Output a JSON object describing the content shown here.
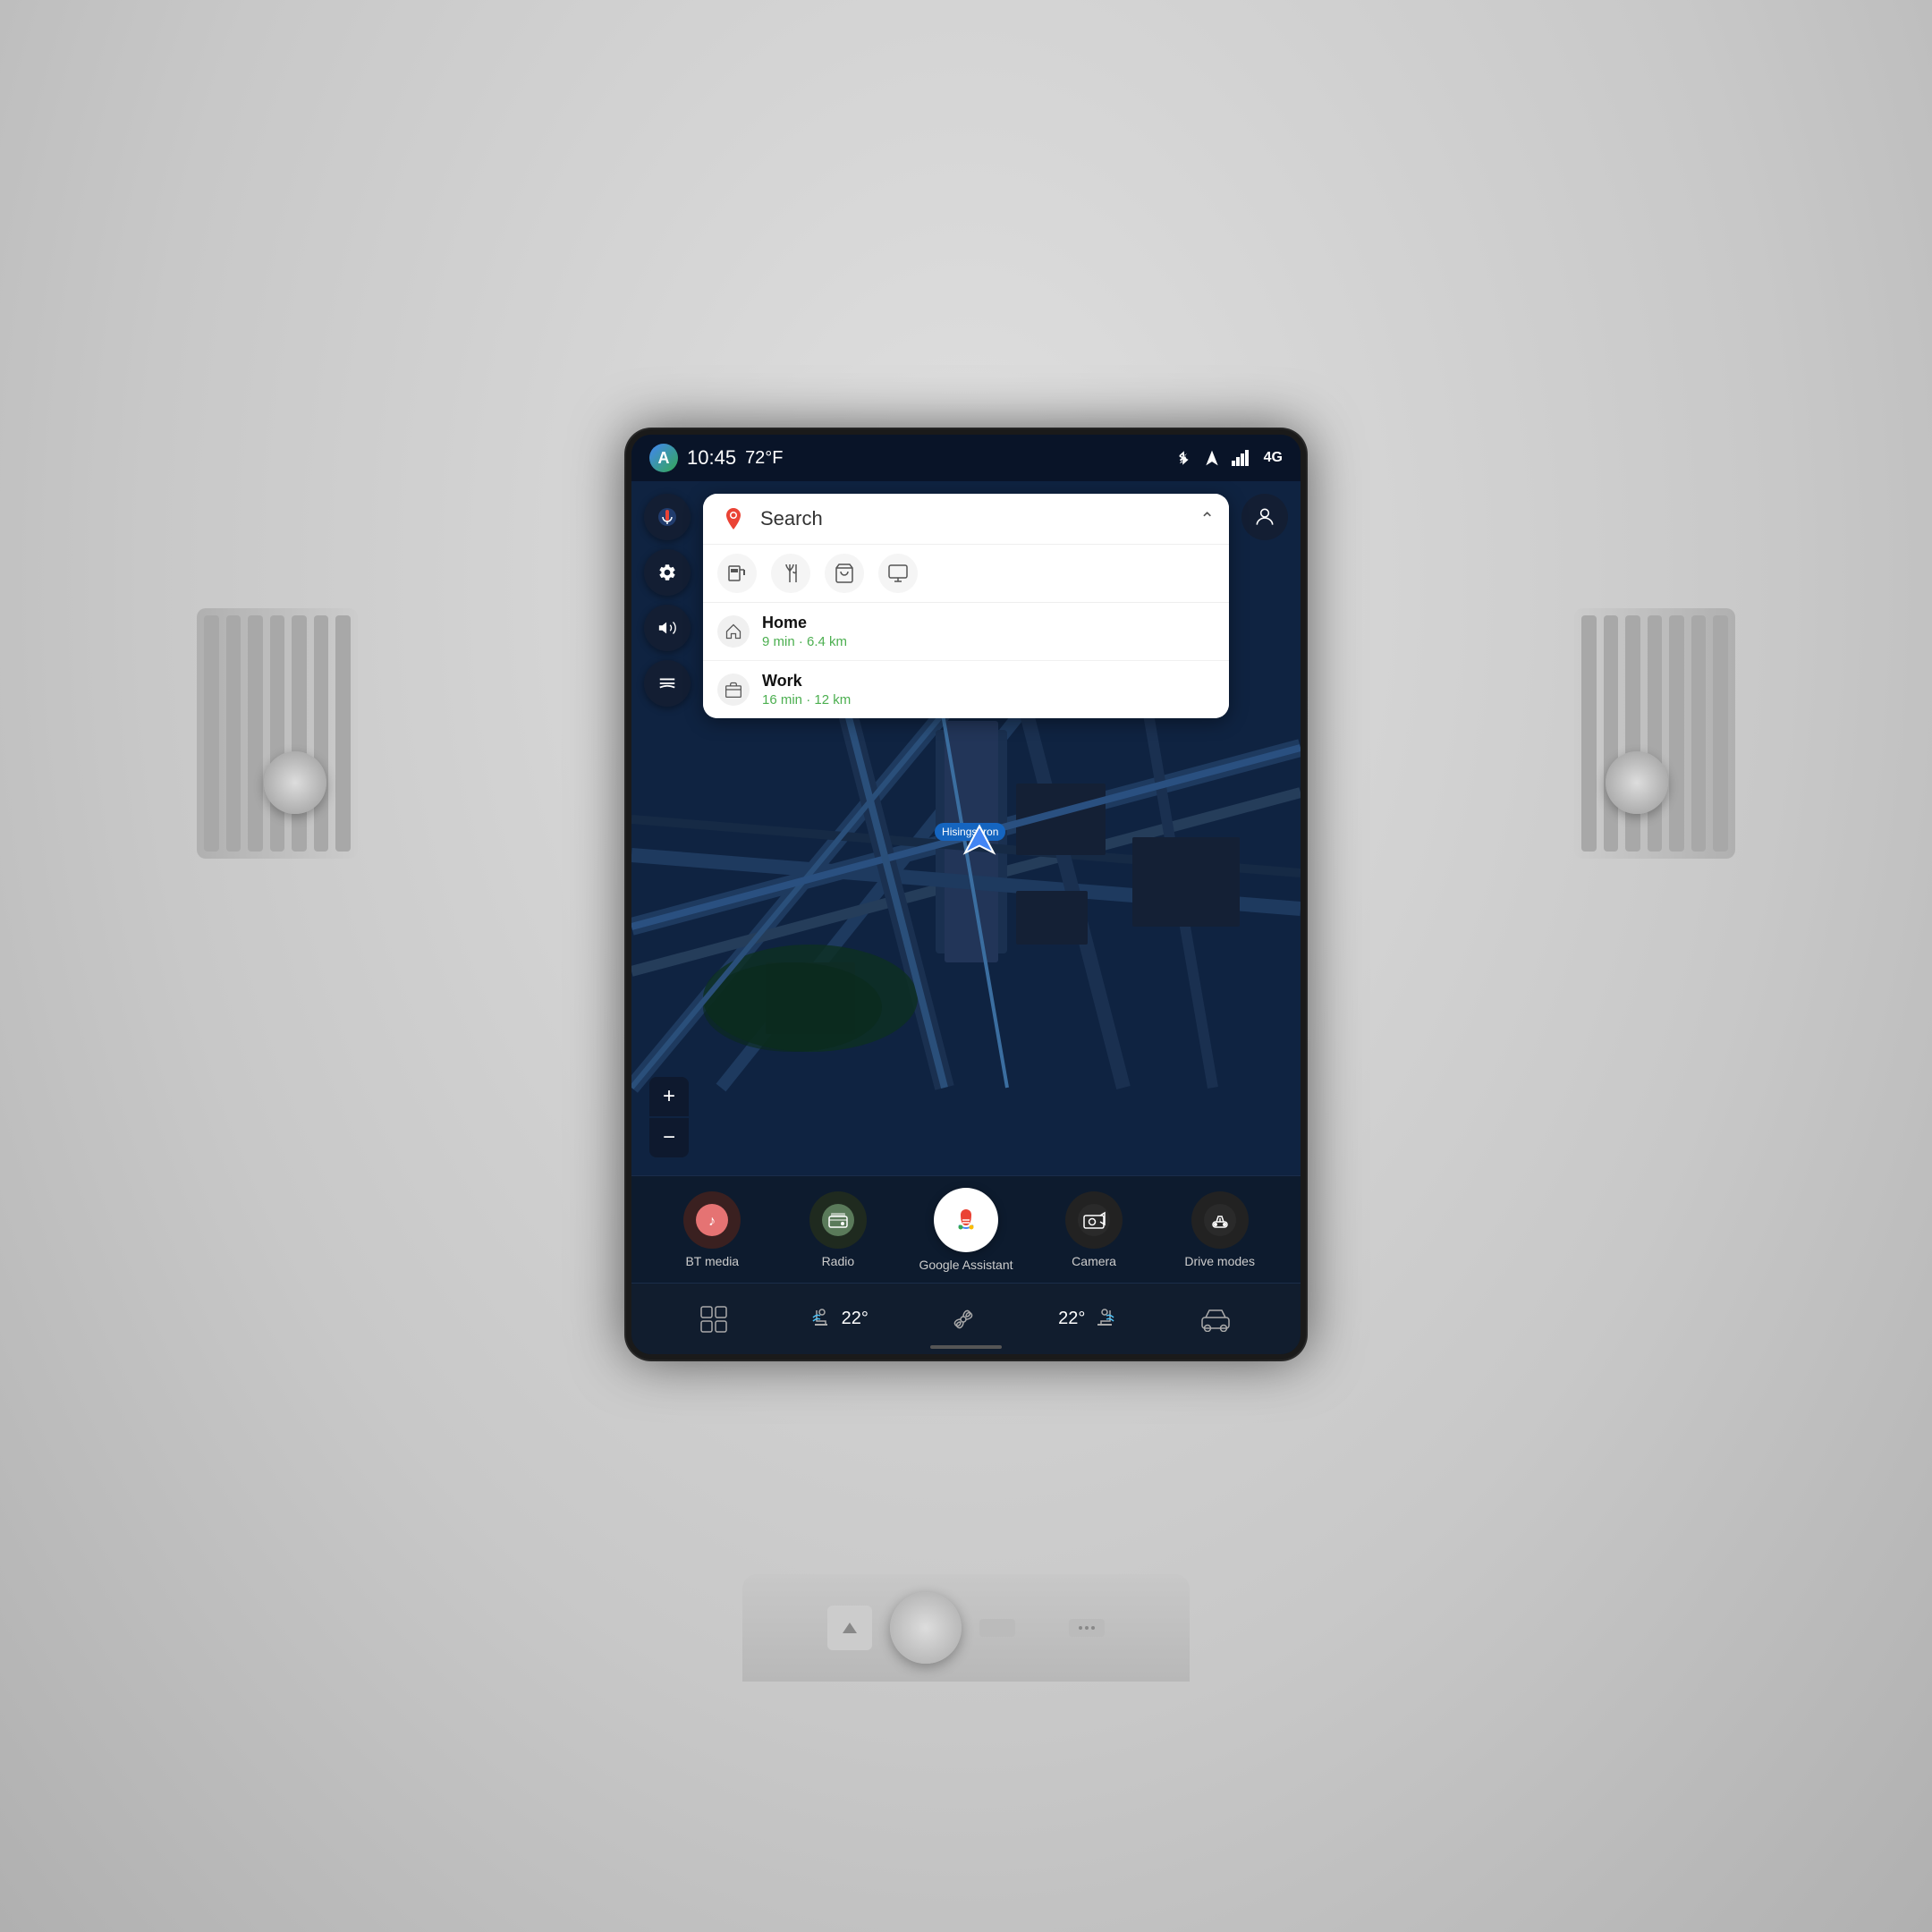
{
  "status_bar": {
    "logo": "A",
    "time": "10:45",
    "temperature": "72°F",
    "bluetooth_icon": "BT",
    "location_icon": "↗",
    "signal_icon": "▪▪▪",
    "network": "4G"
  },
  "search_panel": {
    "placeholder": "Search",
    "chevron": "⌃",
    "categories": [
      {
        "icon": "⛽",
        "name": "gas-category"
      },
      {
        "icon": "🍴",
        "name": "food-category"
      },
      {
        "icon": "🛒",
        "name": "shopping-category"
      },
      {
        "icon": "💻",
        "name": "services-category"
      }
    ],
    "destinations": [
      {
        "icon": "🏠",
        "name": "Home",
        "detail": "9 min · 6.4 km"
      },
      {
        "icon": "💼",
        "name": "Work",
        "detail": "16 min · 12 km"
      }
    ]
  },
  "map": {
    "location_label": "Hisingsbron",
    "zoom_plus": "+",
    "zoom_minus": "−"
  },
  "left_sidebar": [
    {
      "icon": "🎤",
      "name": "voice-button"
    },
    {
      "icon": "⚙",
      "name": "settings-button"
    },
    {
      "icon": "🔊",
      "name": "volume-button"
    },
    {
      "icon": "≡",
      "name": "menu-button"
    }
  ],
  "app_bar": [
    {
      "icon": "BT",
      "label": "BT media",
      "color": "#e57373",
      "bg": "#2a1f1f"
    },
    {
      "icon": "📻",
      "label": "Radio",
      "color": "#81c784",
      "bg": "#1f2a1f"
    },
    {
      "icon": "G",
      "label": "Google Assistant",
      "color": "#fff",
      "bg": "#fff"
    },
    {
      "icon": "📷",
      "label": "Camera",
      "color": "#fff",
      "bg": "#222"
    },
    {
      "icon": "🚗",
      "label": "Drive modes",
      "color": "#fff",
      "bg": "#222"
    }
  ],
  "controls_bar": [
    {
      "icon": "⊞",
      "name": "grid-button"
    },
    {
      "icon": "💺",
      "name": "seat-left-button",
      "value": "22°"
    },
    {
      "icon": "❄",
      "name": "fan-button",
      "value": "22°"
    },
    {
      "icon": "🚗",
      "name": "car-button"
    }
  ]
}
